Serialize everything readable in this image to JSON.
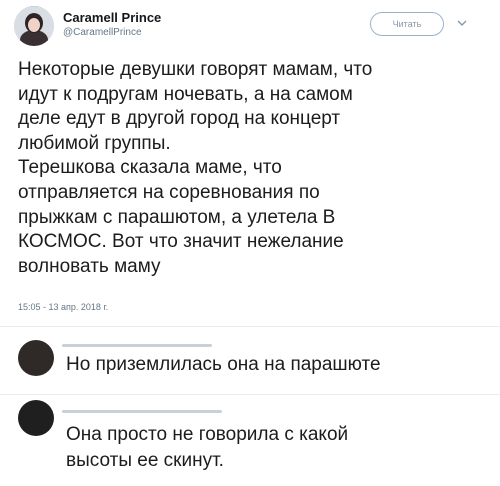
{
  "tweet": {
    "author_name": "Caramell Prince",
    "author_handle": "@CaramellPrince",
    "follow_label": "Читать",
    "text": "Некоторые девушки говорят мамам, что\nидут к подругам ночевать, а на самом\nделе едут в другой город на концерт\nлюбимой группы.\nТерешкова сказала маме, что\nотправляется на соревнования по\nпрыжкам с парашютом, а улетела В\nКОСМОС. Вот что значит нежелание\nволновать маму",
    "timestamp": "15:05 - 13 апр. 2018 г."
  },
  "replies": [
    {
      "text": "Но приземлилась она на парашюте"
    },
    {
      "text": "Она просто не говорила с какой\nвысоты ее скинут."
    }
  ],
  "icons": {
    "chevron": "chevron-down-icon"
  },
  "colors": {
    "text": "#1c1c1c",
    "muted": "#657786",
    "divider": "#e6ecf0"
  }
}
